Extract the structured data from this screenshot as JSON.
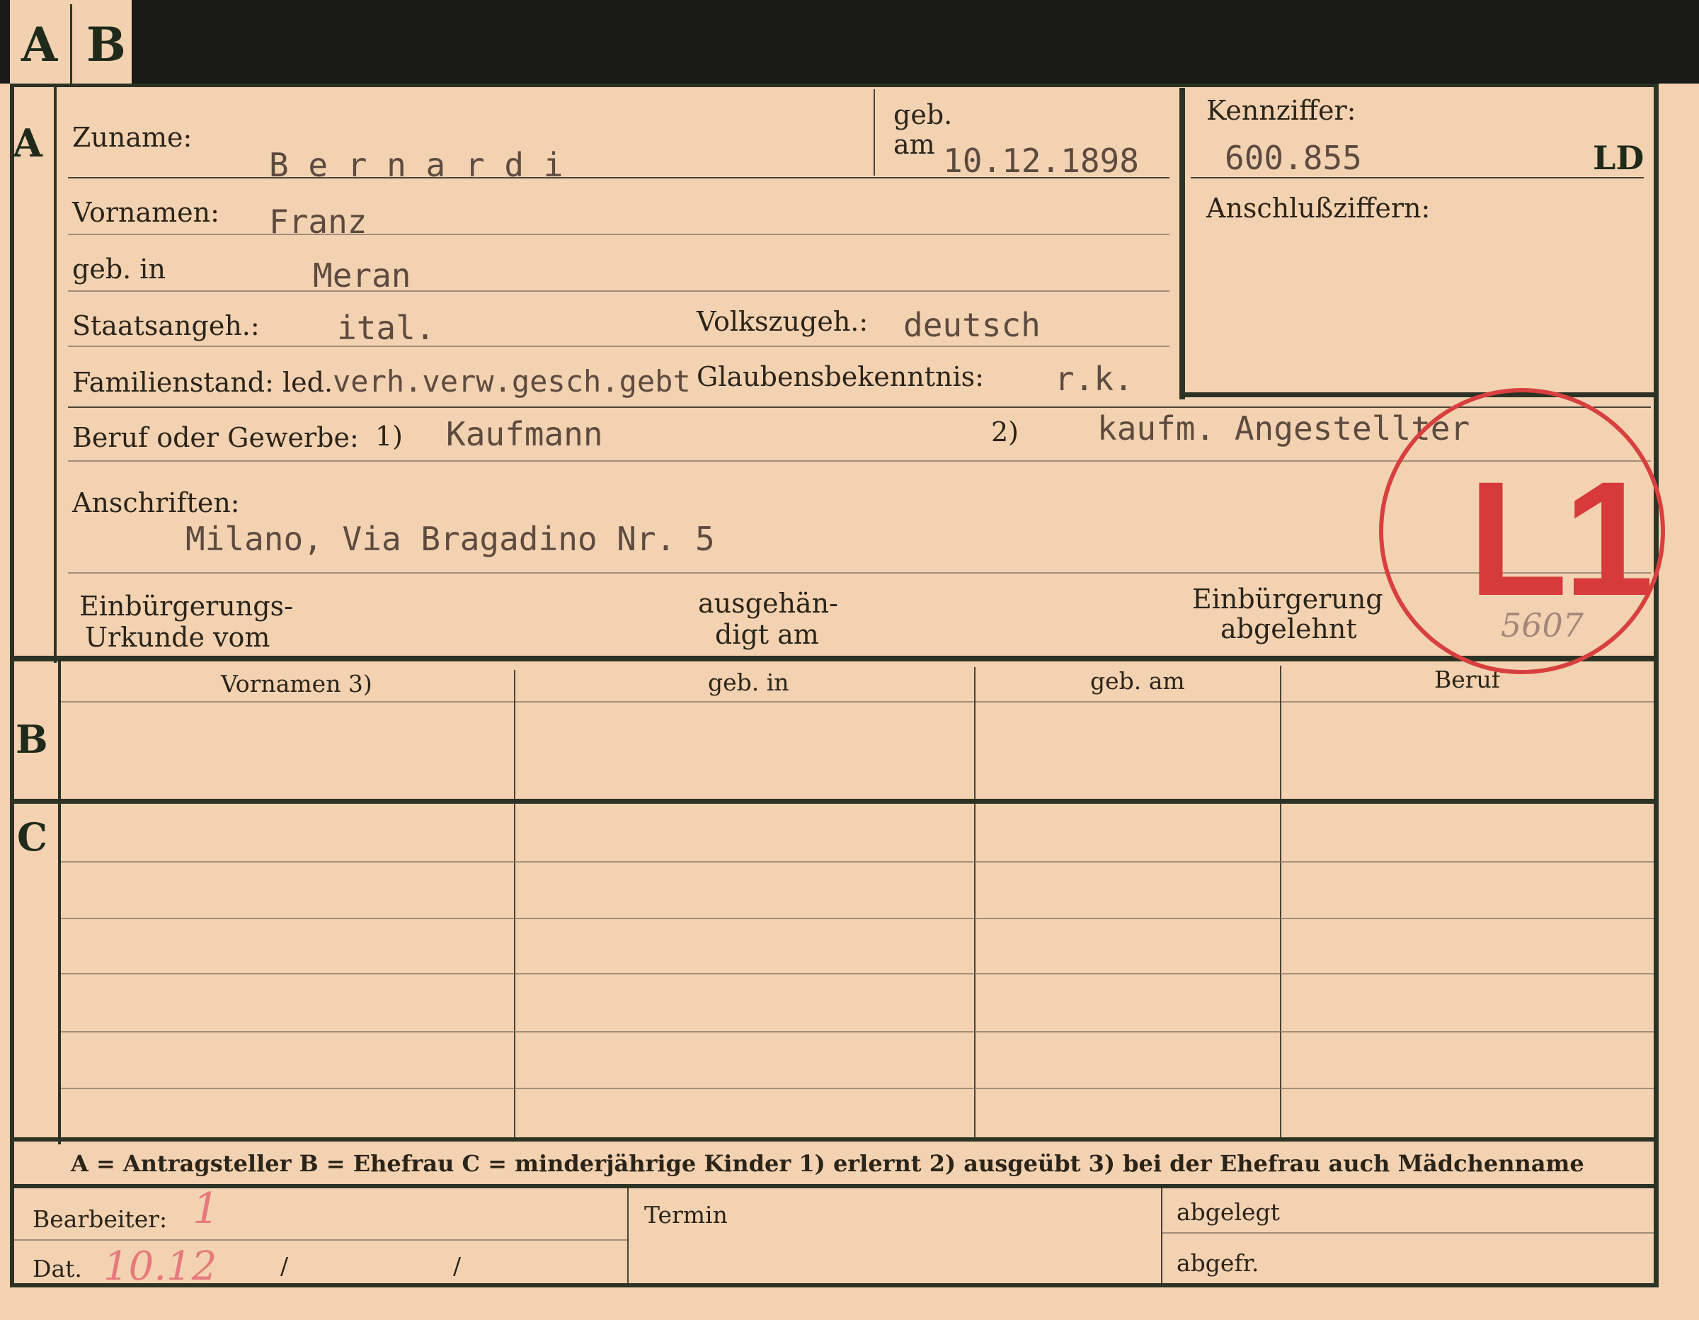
{
  "tab": {
    "a": "A",
    "b": "B"
  },
  "section_markers": {
    "a": "A",
    "b": "B",
    "c": "C"
  },
  "header": {
    "zuname_label": "Zuname:",
    "zuname_value": "B e r n a r d i",
    "geb_am_label_1": "geb.",
    "geb_am_label_2": "am",
    "geb_am_value": "10.12.1898",
    "vornamen_label": "Vornamen:",
    "vornamen_value": "Franz",
    "geb_in_label": "geb. in",
    "geb_in_value": "Meran",
    "staatsangeh_label": "Staatsangeh.:",
    "staatsangeh_value": "ital.",
    "volkszugeh_label": "Volkszugeh.:",
    "volkszugeh_value": "deutsch",
    "familienstand_label": "Familienstand: led.",
    "familienstand_value": "verh.verw.gesch.gebt",
    "glaubens_label": "Glaubensbekenntnis:",
    "glaubens_value": "r.k.",
    "beruf_label": "Beruf oder Gewerbe:",
    "beruf_note_1": "1)",
    "beruf_value_1": "Kaufmann",
    "beruf_note_2": "2)",
    "beruf_value_2": "kaufm. Angestellter",
    "anschriften_label": "Anschriften:",
    "anschriften_value": "Milano, Via Bragadino Nr. 5",
    "einb_urkunde_label_1": "Einbürgerungs-",
    "einb_urkunde_label_2": "Urkunde vom",
    "ausgehaendigt_label_1": "ausgehän-",
    "ausgehaendigt_label_2": "digt am",
    "einb_abgelehnt_label_1": "Einbürgerung",
    "einb_abgelehnt_label_2": "abgelehnt"
  },
  "kennziffer": {
    "label": "Kennziffer:",
    "value": "600.855",
    "suffix": "LD",
    "anschluss_label": "Anschlußziffern:"
  },
  "stamp": {
    "text": "L1",
    "number": "5607"
  },
  "table_b": {
    "headers": [
      "Vornamen 3)",
      "geb. in",
      "geb. am",
      "Beruf"
    ]
  },
  "legend": {
    "text": "A = Antragsteller   B = Ehefrau   C = minderjährige Kinder   1) erlernt   2) ausgeübt   3) bei der Ehefrau auch Mädchenname"
  },
  "footer": {
    "bearbeiter_label": "Bearbeiter:",
    "bearbeiter_value": "1",
    "dat_label": "Dat.",
    "dat_value": "10.12",
    "dat_sep_1": "/",
    "dat_sep_2": "/",
    "termin_label": "Termin",
    "abgelegt_label": "abgelegt",
    "abgefr_label": "abgefr."
  }
}
